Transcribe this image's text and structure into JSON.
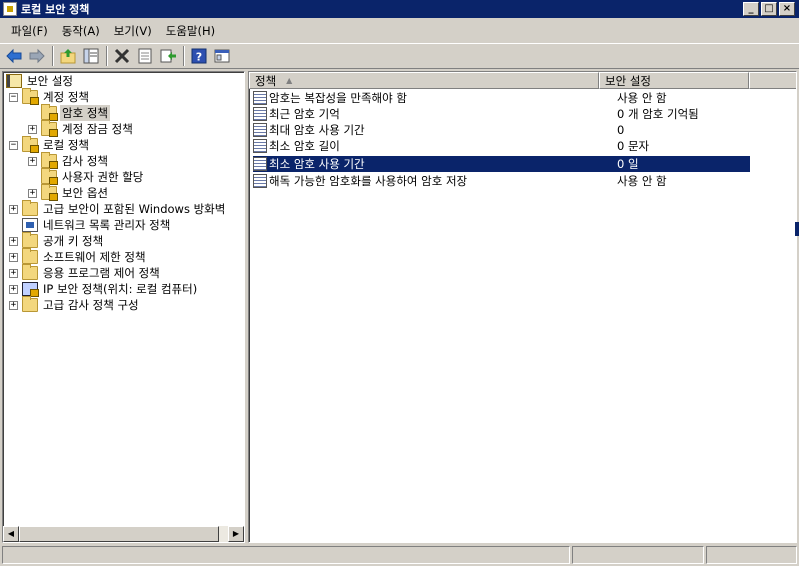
{
  "window": {
    "title": "로컬 보안 정책",
    "buttons": {
      "minimize": "_",
      "maximize": "□",
      "close": "×"
    }
  },
  "menu": [
    "파일(F)",
    "동작(A)",
    "보기(V)",
    "도움말(H)"
  ],
  "toolbar": [
    "back-icon",
    "forward-icon",
    "up-folder-icon",
    "show-tree-icon",
    "delete-icon",
    "properties-icon",
    "export-icon",
    "help-icon",
    "console-tree-icon"
  ],
  "tree": {
    "root": "보안 설정",
    "items": [
      {
        "label": "계정 정책"
      },
      {
        "label": "암호 정책"
      },
      {
        "label": "계정 잠금 정책"
      },
      {
        "label": "로컬 정책"
      },
      {
        "label": "감사 정책"
      },
      {
        "label": "사용자 권한 할당"
      },
      {
        "label": "보안 옵션"
      },
      {
        "label": "고급 보안이 포함된 Windows 방화벽"
      },
      {
        "label": "네트워크 목록 관리자 정책"
      },
      {
        "label": "공개 키 정책"
      },
      {
        "label": "소프트웨어 제한 정책"
      },
      {
        "label": "응용 프로그램 제어 정책"
      },
      {
        "label": "IP 보안 정책(위치: 로컬 컴퓨터)"
      },
      {
        "label": "고급 감사 정책 구성"
      }
    ]
  },
  "list": {
    "columns": [
      "정책",
      "보안 설정"
    ],
    "rows": [
      {
        "policy": "암호는 복잡성을 만족해야 함",
        "setting": "사용 안 함"
      },
      {
        "policy": "최근 암호 기억",
        "setting": "0 개 암호 기억됨"
      },
      {
        "policy": "최대 암호 사용 기간",
        "setting": "0"
      },
      {
        "policy": "최소 암호 길이",
        "setting": "0 문자"
      },
      {
        "policy": "최소 암호 사용 기간",
        "setting": "0 일"
      },
      {
        "policy": "해독 가능한 암호화를 사용하여 암호 저장",
        "setting": "사용 안 함"
      }
    ]
  }
}
